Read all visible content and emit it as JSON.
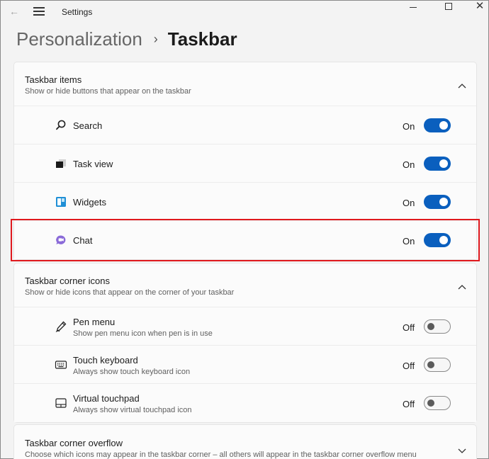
{
  "window": {
    "title": "Settings"
  },
  "breadcrumb": {
    "parent": "Personalization",
    "separator": "›",
    "current": "Taskbar"
  },
  "sections": {
    "taskbar_items": {
      "title": "Taskbar items",
      "subtitle": "Show or hide buttons that appear on the taskbar",
      "items": [
        {
          "label": "Search",
          "state": "On",
          "icon": "search-icon"
        },
        {
          "label": "Task view",
          "state": "On",
          "icon": "task-view-icon"
        },
        {
          "label": "Widgets",
          "state": "On",
          "icon": "widgets-icon"
        },
        {
          "label": "Chat",
          "state": "On",
          "icon": "chat-icon"
        }
      ]
    },
    "corner_icons": {
      "title": "Taskbar corner icons",
      "subtitle": "Show or hide icons that appear on the corner of your taskbar",
      "items": [
        {
          "label": "Pen menu",
          "sub": "Show pen menu icon when pen is in use",
          "state": "Off",
          "icon": "pen-icon"
        },
        {
          "label": "Touch keyboard",
          "sub": "Always show touch keyboard icon",
          "state": "Off",
          "icon": "keyboard-icon"
        },
        {
          "label": "Virtual touchpad",
          "sub": "Always show virtual touchpad icon",
          "state": "Off",
          "icon": "touchpad-icon"
        }
      ]
    },
    "corner_overflow": {
      "title": "Taskbar corner overflow",
      "subtitle": "Choose which icons may appear in the taskbar corner – all others will appear in the taskbar corner overflow menu"
    }
  },
  "colors": {
    "accent": "#0a5fbe",
    "highlight_border": "#e0191e"
  }
}
